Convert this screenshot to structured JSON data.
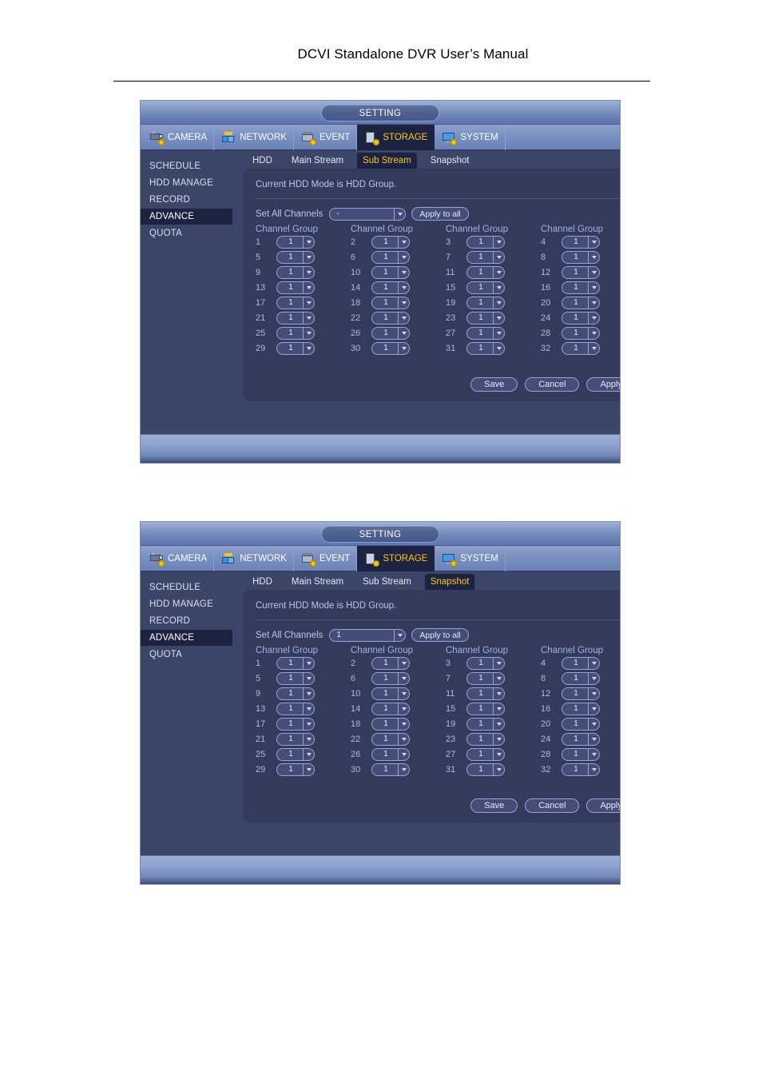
{
  "document": {
    "title": "DCVI Standalone DVR User’s Manual"
  },
  "window": {
    "title": "SETTING",
    "main_nav": [
      {
        "label": "CAMERA",
        "icon": "camera-icon",
        "active": false
      },
      {
        "label": "NETWORK",
        "icon": "network-icon",
        "active": false
      },
      {
        "label": "EVENT",
        "icon": "event-icon",
        "active": false
      },
      {
        "label": "STORAGE",
        "icon": "storage-icon",
        "active": true
      },
      {
        "label": "SYSTEM",
        "icon": "system-icon",
        "active": false
      }
    ],
    "sidebar": [
      {
        "label": "SCHEDULE",
        "active": false
      },
      {
        "label": "HDD MANAGE",
        "active": false
      },
      {
        "label": "RECORD",
        "active": false
      },
      {
        "label": "ADVANCE",
        "active": true
      },
      {
        "label": "QUOTA",
        "active": false
      }
    ],
    "sub_tabs": [
      "HDD",
      "Main Stream",
      "Sub Stream",
      "Snapshot"
    ],
    "hdd_mode_text": "Current HDD Mode is HDD Group.",
    "set_all_label": "Set All Channels",
    "apply_to_all_label": "Apply to all",
    "channel_group_header": "Channel Group",
    "buttons": {
      "save": "Save",
      "cancel": "Cancel",
      "apply": "Apply"
    },
    "channels": [
      {
        "num": "1",
        "group": "1"
      },
      {
        "num": "2",
        "group": "1"
      },
      {
        "num": "3",
        "group": "1"
      },
      {
        "num": "4",
        "group": "1"
      },
      {
        "num": "5",
        "group": "1"
      },
      {
        "num": "6",
        "group": "1"
      },
      {
        "num": "7",
        "group": "1"
      },
      {
        "num": "8",
        "group": "1"
      },
      {
        "num": "9",
        "group": "1"
      },
      {
        "num": "10",
        "group": "1"
      },
      {
        "num": "11",
        "group": "1"
      },
      {
        "num": "12",
        "group": "1"
      },
      {
        "num": "13",
        "group": "1"
      },
      {
        "num": "14",
        "group": "1"
      },
      {
        "num": "15",
        "group": "1"
      },
      {
        "num": "16",
        "group": "1"
      },
      {
        "num": "17",
        "group": "1"
      },
      {
        "num": "18",
        "group": "1"
      },
      {
        "num": "19",
        "group": "1"
      },
      {
        "num": "20",
        "group": "1"
      },
      {
        "num": "21",
        "group": "1"
      },
      {
        "num": "22",
        "group": "1"
      },
      {
        "num": "23",
        "group": "1"
      },
      {
        "num": "24",
        "group": "1"
      },
      {
        "num": "25",
        "group": "1"
      },
      {
        "num": "26",
        "group": "1"
      },
      {
        "num": "27",
        "group": "1"
      },
      {
        "num": "28",
        "group": "1"
      },
      {
        "num": "29",
        "group": "1"
      },
      {
        "num": "30",
        "group": "1"
      },
      {
        "num": "31",
        "group": "1"
      },
      {
        "num": "32",
        "group": "1"
      }
    ],
    "colors": {
      "accent_active": "#ffc322",
      "panel_bg": "#333a5c",
      "window_bg": "#3b4568",
      "active_tab_bg": "#1b2340"
    }
  },
  "screens": [
    {
      "id": "sub-stream",
      "active_sub_tab": "Sub Stream",
      "set_all_value": "-"
    },
    {
      "id": "snapshot",
      "active_sub_tab": "Snapshot",
      "set_all_value": "1"
    }
  ]
}
